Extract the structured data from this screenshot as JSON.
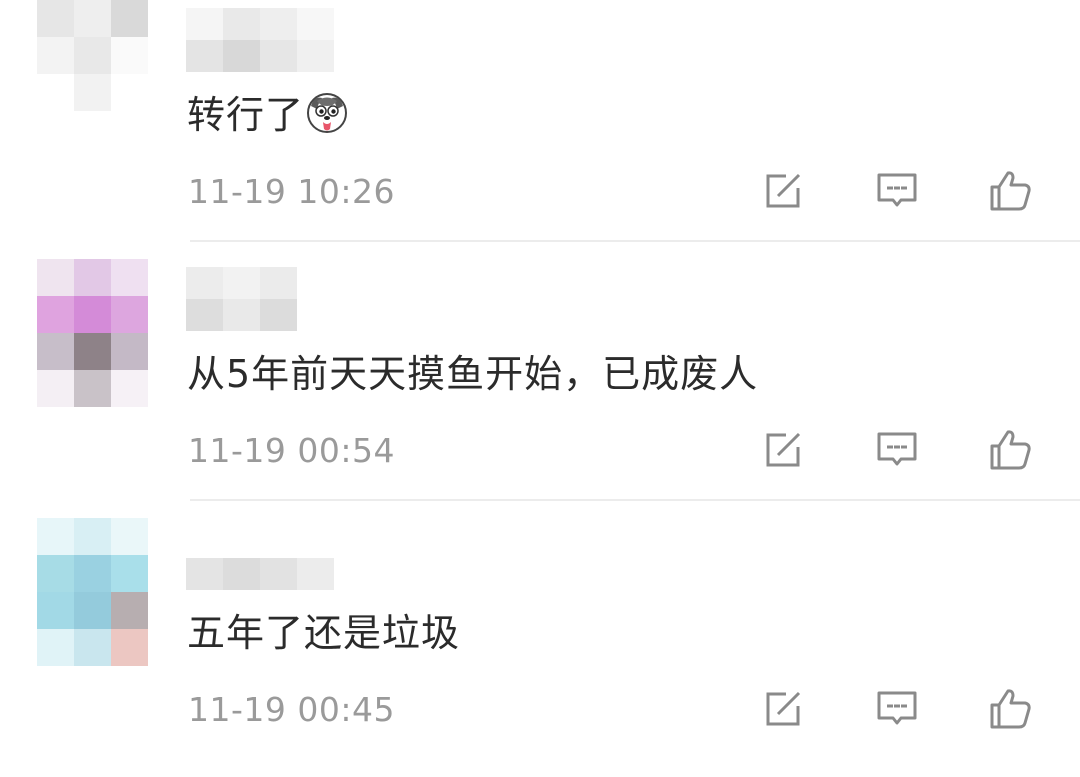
{
  "comments": [
    {
      "text": "转行了",
      "emoji": "husky-doge-emoji",
      "time": "11-19 10:26",
      "avatar_colors": [
        "#e6e6e6",
        "#eeeeee",
        "#d9d9d9",
        "#f3f3f3",
        "#e8e8e8",
        "#fafafa",
        "#ffffff",
        "#f2f2f2",
        "#ffffff",
        "#ffffff",
        "#ffffff",
        "#ffffff"
      ],
      "name_colors": [
        "#f5f5f5",
        "#e9e9e9",
        "#eeeeee",
        "#f7f7f7",
        "#e4e4e4",
        "#d8d8d8",
        "#e6e6e6",
        "#f0f0f0"
      ]
    },
    {
      "text": "从5年前天天摸鱼开始，已成废人",
      "time": "11-19 00:54",
      "avatar_colors": [
        "#efe4ef",
        "#e2c8e6",
        "#efe0f1",
        "#dfa3df",
        "#d48bd8",
        "#dda6df",
        "#c7bec9",
        "#8e8288",
        "#c4b9c6",
        "#f4eff4",
        "#c9c2c8",
        "#f6f1f6"
      ],
      "name_colors": [
        "#ececec",
        "#f2f2f2",
        "#ebebeb",
        "#ffffff",
        "#dddddd",
        "#e9e9e9",
        "#dcdcdc",
        "#ffffff"
      ]
    },
    {
      "text": "五年了还是垃圾",
      "time": "11-19 00:45",
      "avatar_colors": [
        "#e7f6f9",
        "#d8eff4",
        "#eaf7f9",
        "#a7dce6",
        "#9ad1e1",
        "#a9dfea",
        "#a2d9e6",
        "#94cbdc",
        "#b7aeb0",
        "#e0f3f7",
        "#c9e6ee",
        "#ecc7c2"
      ],
      "name_colors": [
        "#ffffff",
        "#ffffff",
        "#ffffff",
        "#ffffff",
        "#e4e4e4",
        "#dcdcdc",
        "#e2e2e2",
        "#ececec"
      ]
    }
  ],
  "actions": {
    "edit_icon": "edit-share-icon",
    "reply_icon": "comment-reply-icon",
    "like_icon": "thumbs-up-icon"
  },
  "colors": {
    "text": "#2b2b2b",
    "meta": "#9a9a9a",
    "icon": "#8a8a8a",
    "divider": "#ececec"
  }
}
